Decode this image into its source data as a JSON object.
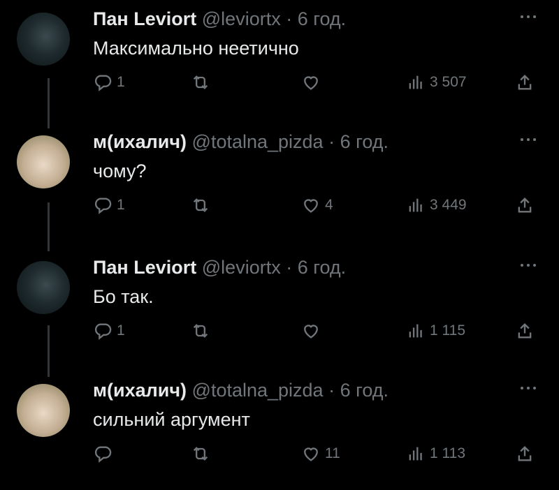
{
  "tweets": [
    {
      "name": "Пан Leviort",
      "handle": "@leviortx",
      "dot": "·",
      "time": "6 год.",
      "text": "Максимально неетично",
      "replies": "1",
      "retweets": "",
      "likes": "",
      "views": "3 507",
      "avatar": "dark"
    },
    {
      "name": "м(ихалич)",
      "handle": "@totalna_pizda",
      "dot": "·",
      "time": "6 год.",
      "text": "чому?",
      "replies": "1",
      "retweets": "",
      "likes": "4",
      "views": "3 449",
      "avatar": "light"
    },
    {
      "name": "Пан Leviort",
      "handle": "@leviortx",
      "dot": "·",
      "time": "6 год.",
      "text": "Бо так.",
      "replies": "1",
      "retweets": "",
      "likes": "",
      "views": "1 115",
      "avatar": "dark"
    },
    {
      "name": "м(ихалич)",
      "handle": "@totalna_pizda",
      "dot": "·",
      "time": "6 год.",
      "text": "сильний аргумент",
      "replies": "",
      "retweets": "",
      "likes": "11",
      "views": "1 113",
      "avatar": "light"
    }
  ],
  "icons": {
    "reply": "reply-icon",
    "retweet": "retweet-icon",
    "like": "heart-icon",
    "views": "views-chart-icon",
    "share": "share-icon",
    "more": "more-dots-icon"
  },
  "colors": {
    "background": "#000000",
    "text": "#e7e9ea",
    "muted": "#71767b",
    "thread_line": "#333639"
  }
}
